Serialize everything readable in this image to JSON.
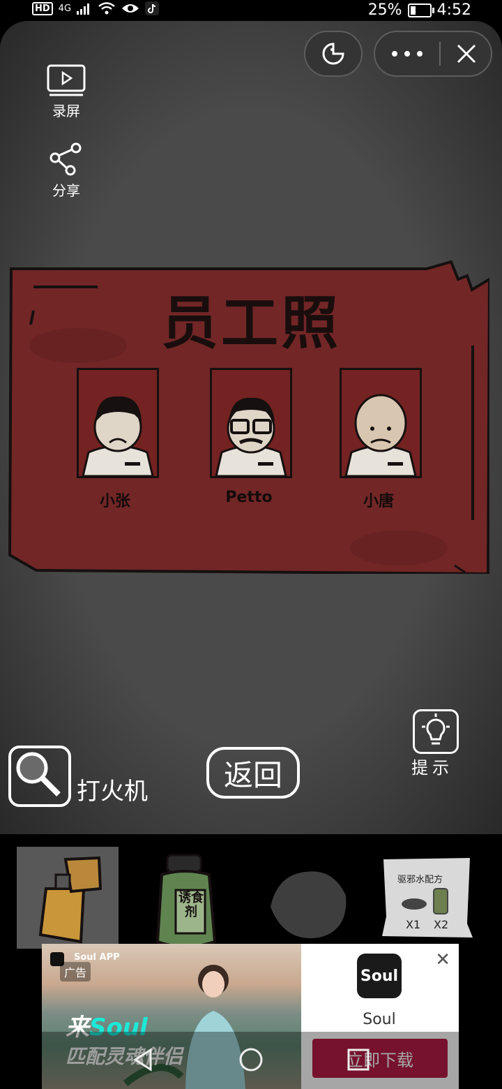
{
  "status_bar": {
    "hd": "HD",
    "network": "4G",
    "battery": "25%",
    "time": "4:52"
  },
  "toolbar": {
    "record_label": "录屏",
    "share_label": "分享"
  },
  "card": {
    "title": "员工照",
    "staff": [
      {
        "name": "小张"
      },
      {
        "name": "Petto"
      },
      {
        "name": "小唐"
      }
    ]
  },
  "controls": {
    "selected_item_label": "打火机",
    "return_label": "返回",
    "hint_label": "提示"
  },
  "inventory": {
    "potion_text": "诱食剂",
    "recipe_title": "驱邪水配方",
    "recipe_x1": "X1",
    "recipe_x2": "X2"
  },
  "ad": {
    "app_tag": "Soul APP",
    "ad_label": "广告",
    "slogan_prefix": "来",
    "slogan_brand": "Soul",
    "slogan_line2": "匹配灵魂伴侣",
    "logo_text": "Soul",
    "app_name": "Soul",
    "download_label": "立即下载"
  },
  "colors": {
    "card_red": "#722626",
    "game_bg": "#4a4a4a",
    "download_red": "#b51d47",
    "soul_cyan": "#1de9d8"
  }
}
